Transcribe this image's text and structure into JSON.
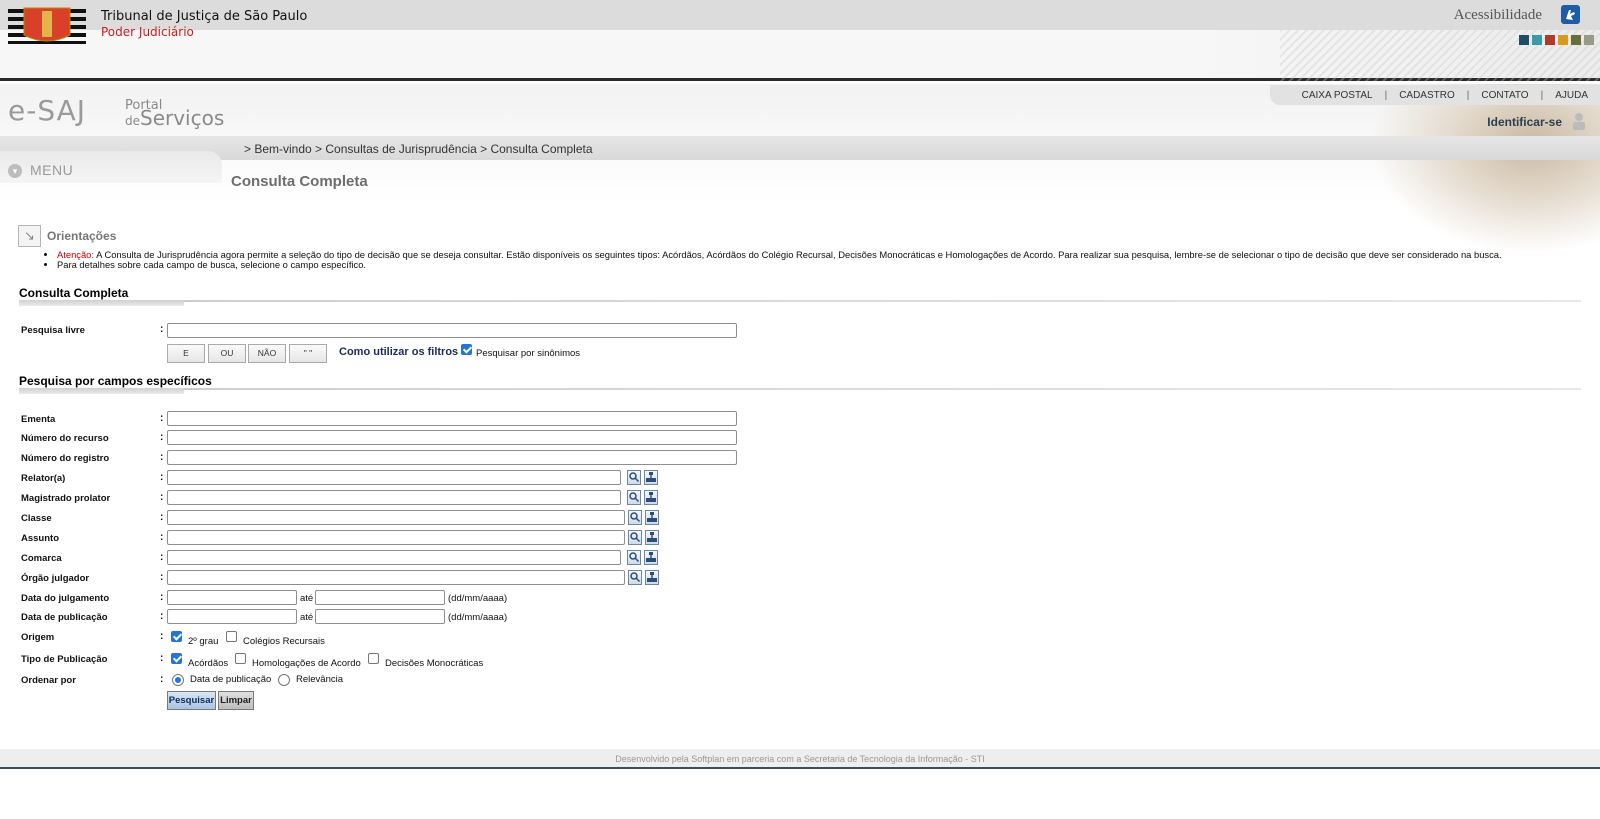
{
  "topbar": {
    "accessibility_label": "Acessibilidade"
  },
  "header": {
    "org_name": "Tribunal de Justiça de São Paulo",
    "org_sub": "Poder Judiciário",
    "color_swatches": [
      "#1d4e63",
      "#3b9aa6",
      "#b23a2a",
      "#d89a1d",
      "#6a6e3a",
      "#9a9a8a"
    ]
  },
  "esaj": {
    "logo_text": "e-SAJ",
    "portal_line1": "Portal",
    "portal_line2": "de",
    "portal_line3": "Serviços"
  },
  "toplinks": [
    "CAIXA POSTAL",
    "CADASTRO",
    "CONTATO",
    "AJUDA"
  ],
  "identify_label": "Identificar-se",
  "breadcrumb": "> Bem-vindo > Consultas de Jurisprudência > Consulta Completa",
  "menu_label": "MENU",
  "page_title": "Consulta Completa",
  "orientations": {
    "title": "Orientações",
    "attention_label": "Atenção:",
    "item1": " A Consulta de Jurisprudência agora permite a seleção do tipo de decisão que se deseja consultar. Estão disponíveis os seguintes tipos: Acórdãos, Acórdãos do Colégio Recursal, Decisões Monocráticas e Homologações de Acordo. Para realizar sua pesquisa, lembre-se de selecionar o tipo de decisão que deve ser considerado na busca.",
    "item2": "Para detalhes sobre cada campo de busca, selecione o campo específico."
  },
  "section1": {
    "title": "Consulta Completa",
    "free_search_label": "Pesquisa livre",
    "operators": [
      "E",
      "OU",
      "NÃO",
      "\" \""
    ],
    "filters_link": "Como utilizar os filtros",
    "synonyms_label": "Pesquisar por sinônimos",
    "synonyms_checked": true
  },
  "section2": {
    "title": "Pesquisa por campos específicos",
    "fields": {
      "ementa": "Ementa",
      "numero_recurso": "Número do recurso",
      "numero_registro": "Número do registro",
      "relator": "Relator(a)",
      "magistrado": "Magistrado prolator",
      "classe": "Classe",
      "assunto": "Assunto",
      "comarca": "Comarca",
      "orgao": "Órgão julgador",
      "data_julgamento": "Data do julgamento",
      "data_publicacao": "Data de publicação",
      "origem": "Origem",
      "tipo_publicacao": "Tipo de Publicação",
      "ordenar_por": "Ordenar por"
    },
    "date_between": "até",
    "date_format": "(dd/mm/aaaa)",
    "origem_options": [
      {
        "label": "2º grau",
        "checked": true
      },
      {
        "label": "Colégios Recursais",
        "checked": false
      }
    ],
    "tipo_options": [
      {
        "label": "Acórdãos",
        "checked": true
      },
      {
        "label": "Homologações de Acordo",
        "checked": false
      },
      {
        "label": "Decisões Monocráticas",
        "checked": false
      }
    ],
    "ordenar_options": [
      {
        "label": "Data de publicação",
        "selected": true
      },
      {
        "label": "Relevância",
        "selected": false
      }
    ],
    "search_button": "Pesquisar",
    "clear_button": "Limpar"
  },
  "footer": "Desenvolvido pela Softplan em parceria com a Secretaria de Tecnologia da Informação - STI",
  "icons": {
    "lookup": "search-icon",
    "tree": "tree-icon",
    "accessibility": "accessibility-icon"
  }
}
